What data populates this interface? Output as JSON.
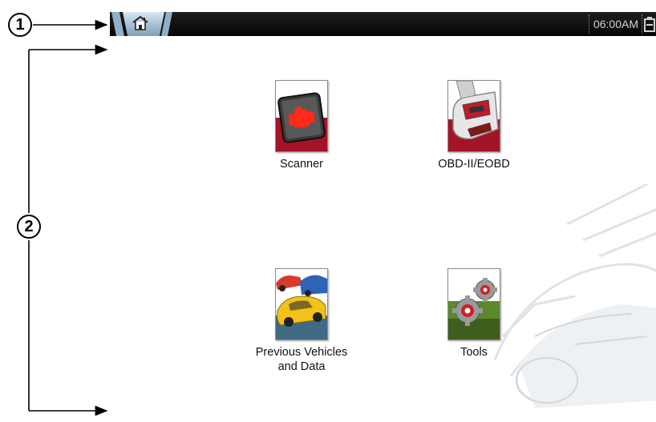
{
  "annotations": {
    "callout_1": "1",
    "callout_2": "2"
  },
  "title_bar": {
    "home_icon": "home-icon",
    "time": "06:00AM",
    "battery_icon": "battery-icon"
  },
  "apps": [
    {
      "label": "Scanner",
      "icon": "engine-warning-icon"
    },
    {
      "label": "OBD-II/EOBD",
      "icon": "obd-connector-icon"
    },
    {
      "label": "Previous Vehicles\nand Data",
      "icon": "vehicles-icon"
    },
    {
      "label": "Tools",
      "icon": "gears-icon"
    }
  ],
  "colors": {
    "title_bar": "#0a0a0a",
    "tile_red": "#b0182a",
    "clock_text": "#d2d2d2"
  }
}
